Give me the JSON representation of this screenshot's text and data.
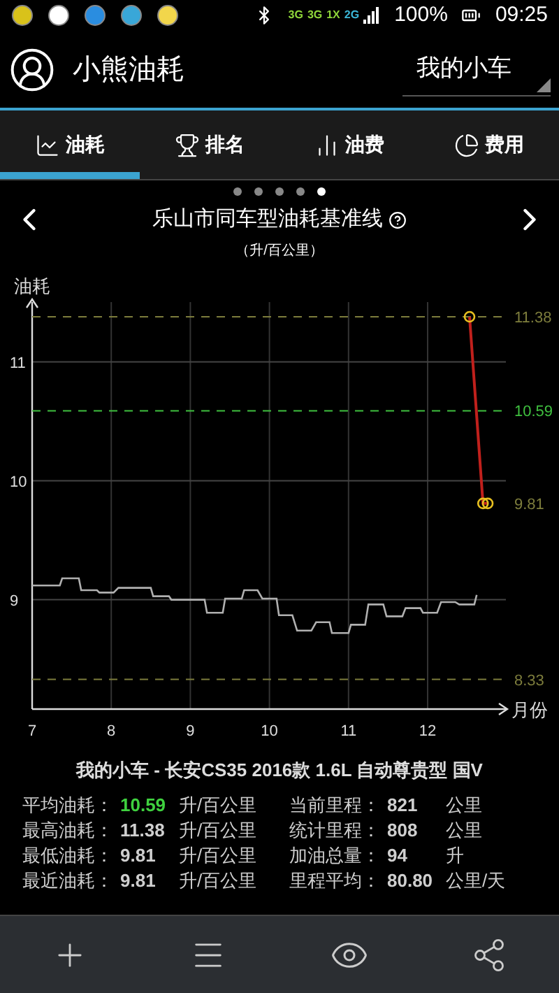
{
  "status_bar": {
    "networks": [
      "3G",
      "3G",
      "1X",
      "2G"
    ],
    "battery": "100%",
    "time": "09:25"
  },
  "header": {
    "title": "小熊油耗",
    "car_select": "我的小车"
  },
  "tabs": [
    {
      "label": "油耗",
      "selected": true
    },
    {
      "label": "排名",
      "selected": false
    },
    {
      "label": "油费",
      "selected": false
    },
    {
      "label": "费用",
      "selected": false
    }
  ],
  "pager": [
    {
      "selected": false
    },
    {
      "selected": false
    },
    {
      "selected": false
    },
    {
      "selected": false
    },
    {
      "selected": true
    }
  ],
  "chart": {
    "title": "乐山市同车型油耗基准线",
    "subtitle": "（升/百公里）",
    "chart_data": {
      "type": "line",
      "ylabel": "油耗",
      "xlabel": "月份",
      "xlim": [
        7,
        13
      ],
      "ylim": [
        8.08,
        11.48
      ],
      "xticks": [
        7,
        8,
        9,
        10,
        11,
        12
      ],
      "yticks": [
        9,
        10,
        11
      ],
      "grid": true,
      "series": [
        {
          "color": "#b0b0b0",
          "x": [
            7.0,
            7.35,
            7.38,
            7.59,
            7.62,
            7.82,
            7.85,
            8.03,
            8.09,
            8.5,
            8.53,
            8.73,
            8.76,
            9.18,
            9.21,
            9.41,
            9.44,
            9.65,
            9.68,
            9.85,
            9.91,
            10.09,
            10.12,
            10.29,
            10.35,
            10.53,
            10.59,
            10.76,
            10.79,
            11.0,
            11.03,
            11.21,
            11.25,
            11.44,
            11.48,
            11.68,
            11.72,
            11.91,
            11.94,
            12.12,
            12.17,
            12.35,
            12.4,
            12.59,
            12.62
          ],
          "values": [
            9.12,
            9.12,
            9.18,
            9.18,
            9.08,
            9.08,
            9.06,
            9.06,
            9.1,
            9.1,
            9.03,
            9.03,
            9.0,
            9.0,
            8.89,
            8.89,
            9.01,
            9.01,
            9.08,
            9.08,
            9.01,
            9.01,
            8.87,
            8.87,
            8.74,
            8.74,
            8.81,
            8.81,
            8.72,
            8.72,
            8.79,
            8.79,
            8.96,
            8.96,
            8.86,
            8.86,
            8.93,
            8.93,
            8.89,
            8.89,
            8.98,
            8.98,
            8.96,
            8.96,
            9.04
          ]
        },
        {
          "name": "11.38",
          "color": "#7d7d3c",
          "line_style": "--",
          "x": [
            7,
            13
          ],
          "values": [
            11.38,
            11.38
          ]
        },
        {
          "name": "10.59",
          "color": "#3fbf3f",
          "line_style": "--",
          "x": [
            7,
            13
          ],
          "values": [
            10.59,
            10.59
          ]
        },
        {
          "name": "8.33",
          "color": "#7d7d3c",
          "line_style": "--",
          "x": [
            7,
            13
          ],
          "values": [
            8.33,
            8.33
          ]
        },
        {
          "color": "#c0201c",
          "marker": "o",
          "x": [
            12.53,
            12.7,
            12.76
          ],
          "values": [
            11.38,
            9.81,
            9.81
          ]
        }
      ],
      "annotations": [
        "9.81"
      ]
    }
  },
  "car_title": "我的小车 - 长安CS35 2016款 1.6L 自动尊贵型 国V",
  "stats_left": [
    {
      "label": "平均油耗：",
      "value": "10.59",
      "unit": "升/百公里",
      "highlight": true
    },
    {
      "label": "最高油耗：",
      "value": "11.38",
      "unit": "升/百公里",
      "highlight": false
    },
    {
      "label": "最低油耗：",
      "value": "9.81",
      "unit": "升/百公里",
      "highlight": false
    },
    {
      "label": "最近油耗：",
      "value": "9.81",
      "unit": "升/百公里",
      "highlight": false
    }
  ],
  "stats_right": [
    {
      "label": "当前里程：",
      "value": "821",
      "unit": "公里",
      "highlight": false
    },
    {
      "label": "统计里程：",
      "value": "808",
      "unit": "公里",
      "highlight": false
    },
    {
      "label": "加油总量：",
      "value": "94",
      "unit": "升",
      "highlight": false
    },
    {
      "label": "里程平均：",
      "value": "80.80",
      "unit": "公里/天",
      "highlight": false
    }
  ]
}
